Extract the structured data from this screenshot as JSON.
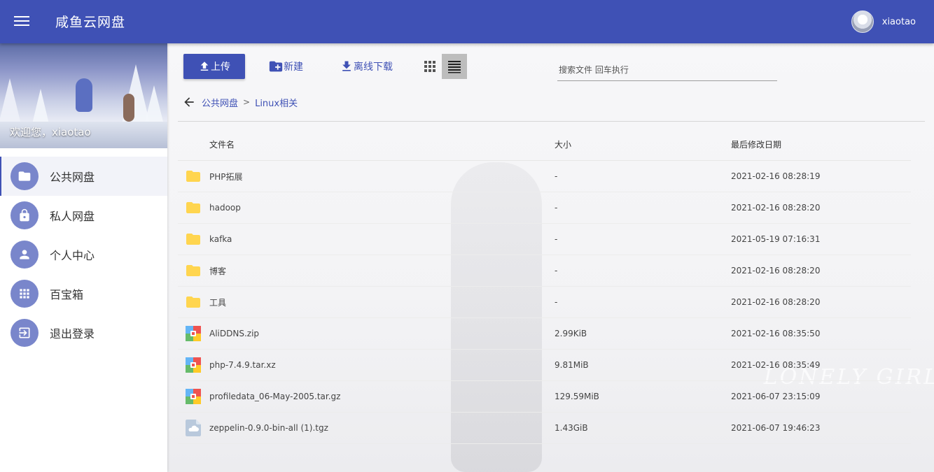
{
  "app": {
    "title": "咸鱼云网盘"
  },
  "user": {
    "name": "xiaotao"
  },
  "sidebar": {
    "welcome": "欢迎您，xiaotao",
    "items": [
      {
        "label": "公共网盘",
        "icon": "folder-icon",
        "active": true
      },
      {
        "label": "私人网盘",
        "icon": "lock-icon",
        "active": false
      },
      {
        "label": "个人中心",
        "icon": "person-icon",
        "active": false
      },
      {
        "label": "百宝箱",
        "icon": "apps-grid-icon",
        "active": false
      },
      {
        "label": "退出登录",
        "icon": "logout-icon",
        "active": false
      }
    ]
  },
  "toolbar": {
    "upload_label": "上传",
    "new_label": "新建",
    "offline_label": "离线下载",
    "view_modes": [
      "grid",
      "list"
    ],
    "active_view": "list"
  },
  "search": {
    "placeholder": "搜索文件 回车执行",
    "value": ""
  },
  "breadcrumb": {
    "root": "公共网盘",
    "separator": ">",
    "current": "Linux相关"
  },
  "table": {
    "headers": {
      "name": "文件名",
      "size": "大小",
      "date": "最后修改日期"
    },
    "rows": [
      {
        "name": "PHP拓展",
        "size": "-",
        "date": "2021-02-16 08:28:19",
        "type": "folder"
      },
      {
        "name": "hadoop",
        "size": "-",
        "date": "2021-02-16 08:28:20",
        "type": "folder"
      },
      {
        "name": "kafka",
        "size": "-",
        "date": "2021-05-19 07:16:31",
        "type": "folder"
      },
      {
        "name": "博客",
        "size": "-",
        "date": "2021-02-16 08:28:20",
        "type": "folder"
      },
      {
        "name": "工具",
        "size": "-",
        "date": "2021-02-16 08:28:20",
        "type": "folder"
      },
      {
        "name": "AliDDNS.zip",
        "size": "2.99KiB",
        "date": "2021-02-16 08:35:50",
        "type": "archive"
      },
      {
        "name": "php-7.4.9.tar.xz",
        "size": "9.81MiB",
        "date": "2021-02-16 08:35:49",
        "type": "archive"
      },
      {
        "name": "profiledata_06-May-2005.tar.gz",
        "size": "129.59MiB",
        "date": "2021-06-07 23:15:09",
        "type": "archive"
      },
      {
        "name": "zeppelin-0.9.0-bin-all (1).tgz",
        "size": "1.43GiB",
        "date": "2021-06-07 19:46:23",
        "type": "cloud-file"
      }
    ]
  },
  "background": {
    "watermark": "LONELY GIRL"
  },
  "colors": {
    "primary": "#3f51b5",
    "nav_icon_bg": "#7986cb",
    "folder": "#ffd54f"
  }
}
